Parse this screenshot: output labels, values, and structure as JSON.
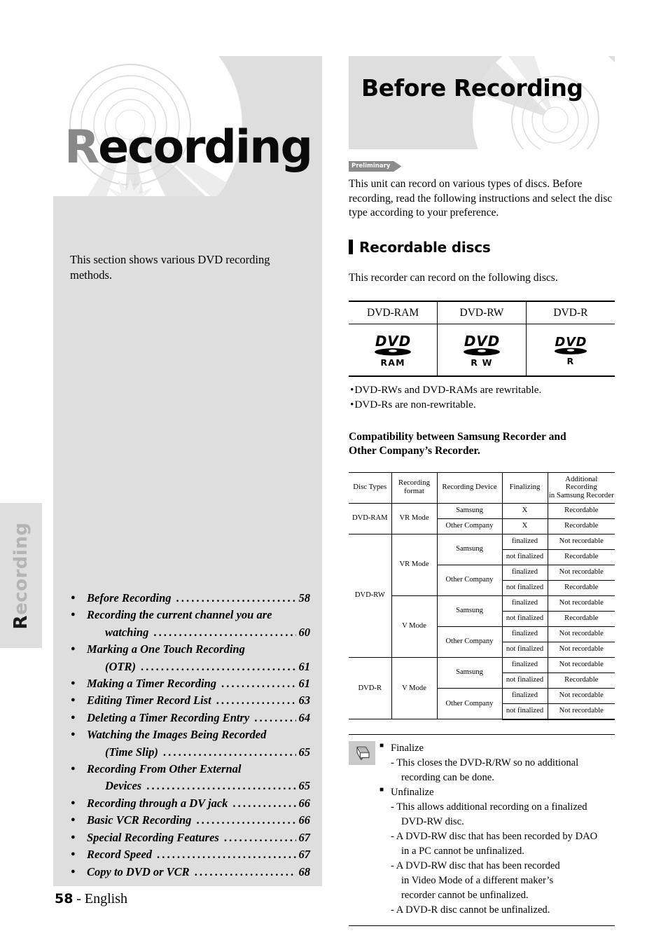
{
  "left": {
    "hero_title_first": "R",
    "hero_title_rest": "ecording",
    "intro": "This section shows various DVD recording methods.",
    "side_tab_first": "R",
    "side_tab_rest": "ecording",
    "toc": [
      {
        "label": "Before Recording",
        "page": "58",
        "cont": null
      },
      {
        "label": "Recording the current channel you are",
        "cont": "watching",
        "page": "60"
      },
      {
        "label": "Marking a One Touch Recording",
        "cont": "(OTR)",
        "page": "61"
      },
      {
        "label": "Making a Timer Recording",
        "page": "61",
        "cont": null
      },
      {
        "label": "Editing Timer Record List",
        "page": "63",
        "cont": null
      },
      {
        "label": "Deleting a Timer Recording Entry",
        "page": "64",
        "cont": null
      },
      {
        "label": "Watching the Images Being Recorded",
        "cont": "(Time Slip)",
        "page": "65"
      },
      {
        "label": "Recording From Other External",
        "cont": "Devices",
        "page": "65"
      },
      {
        "label": "Recording through a DV jack",
        "page": "66",
        "cont": null
      },
      {
        "label": "Basic VCR Recording",
        "page": "66",
        "cont": null
      },
      {
        "label": "Special Recording Features",
        "page": "67",
        "cont": null
      },
      {
        "label": "Record Speed",
        "page": "67",
        "cont": null
      },
      {
        "label": "Copy to DVD or VCR",
        "page": "68",
        "cont": null
      }
    ],
    "footer_page": "58",
    "footer_lang": "- English"
  },
  "right": {
    "hero_title": "Before Recording",
    "preliminary_badge": "Preliminary",
    "intro_para": "This unit can record on various types of discs. Before recording, read the following instructions and select the disc type according to your preference.",
    "section_title": "Recordable discs",
    "section_para": "This recorder can record on the following discs.",
    "disc_table": {
      "headers": [
        "DVD-RAM",
        "DVD-RW",
        "DVD-R"
      ],
      "logo_labels": [
        "RAM",
        "R W",
        "R"
      ],
      "logo_wordmark": "DVD"
    },
    "disc_notes": [
      "DVD-RWs and DVD-RAMs are rewritable.",
      "DVD-Rs are non-rewritable."
    ],
    "compat_heading_line1": "Compatibility between Samsung Recorder and",
    "compat_heading_line2": "Other Company’s Recorder.",
    "compat_table": {
      "headers": [
        "Disc Types",
        "Recording\nformat",
        "Recording Device",
        "Finalizing",
        "Additional Recording\nin Samsung Recorder"
      ],
      "header_parts": [
        [
          "Disc Types"
        ],
        [
          "Recording",
          "format"
        ],
        [
          "Recording Device"
        ],
        [
          "Finalizing"
        ],
        [
          "Additional Recording",
          "in Samsung Recorder"
        ]
      ],
      "rows": [
        {
          "disc": "DVD-RAM",
          "format": "VR Mode",
          "device": "Samsung",
          "finalizing": "X",
          "additional": "Recordable"
        },
        {
          "disc": "DVD-RAM",
          "format": "VR Mode",
          "device": "Other Company",
          "finalizing": "X",
          "additional": "Recordable"
        },
        {
          "disc": "DVD-RW",
          "format": "VR Mode",
          "device": "Samsung",
          "finalizing": "finalized",
          "additional": "Not recordable"
        },
        {
          "disc": "DVD-RW",
          "format": "VR Mode",
          "device": "Samsung",
          "finalizing": "not finalized",
          "additional": "Recordable"
        },
        {
          "disc": "DVD-RW",
          "format": "VR Mode",
          "device": "Other Company",
          "finalizing": "finalized",
          "additional": "Not recordable"
        },
        {
          "disc": "DVD-RW",
          "format": "VR Mode",
          "device": "Other Company",
          "finalizing": "not finalized",
          "additional": "Recordable"
        },
        {
          "disc": "DVD-RW",
          "format": "V Mode",
          "device": "Samsung",
          "finalizing": "finalized",
          "additional": "Not recordable"
        },
        {
          "disc": "DVD-RW",
          "format": "V Mode",
          "device": "Samsung",
          "finalizing": "not finalized",
          "additional": "Recordable"
        },
        {
          "disc": "DVD-RW",
          "format": "V Mode",
          "device": "Other Company",
          "finalizing": "finalized",
          "additional": "Not recordable"
        },
        {
          "disc": "DVD-RW",
          "format": "V Mode",
          "device": "Other Company",
          "finalizing": "not finalized",
          "additional": "Not recordable"
        },
        {
          "disc": "DVD-R",
          "format": "V Mode",
          "device": "Samsung",
          "finalizing": "finalized",
          "additional": "Not recordable"
        },
        {
          "disc": "DVD-R",
          "format": "V Mode",
          "device": "Samsung",
          "finalizing": "not finalized",
          "additional": "Recordable"
        },
        {
          "disc": "DVD-R",
          "format": "V Mode",
          "device": "Other Company",
          "finalizing": "finalized",
          "additional": "Not recordable"
        },
        {
          "disc": "DVD-R",
          "format": "V Mode",
          "device": "Other Company",
          "finalizing": "not finalized",
          "additional": "Not recordable"
        }
      ]
    },
    "note": {
      "items": [
        {
          "head": "Finalize",
          "lines": [
            "- This closes the DVD-R/RW so no additional",
            "recording can be done."
          ]
        },
        {
          "head": "Unfinalize",
          "lines": [
            "- This allows additional recording on a finalized",
            "DVD-RW disc.",
            "- A DVD-RW disc that has been recorded by DAO",
            "in a PC cannot be unfinalized.",
            "- A DVD-RW disc that has been recorded",
            "in Video Mode of a different maker’s",
            "recorder cannot be unfinalized.",
            "- A DVD-R disc cannot be unfinalized."
          ]
        }
      ]
    }
  },
  "colors": {
    "panel_gray": "#dedede",
    "badge_gray": "#8c8c8c",
    "icon_gray": "#c9c9c9",
    "title_gray": "#888888"
  }
}
